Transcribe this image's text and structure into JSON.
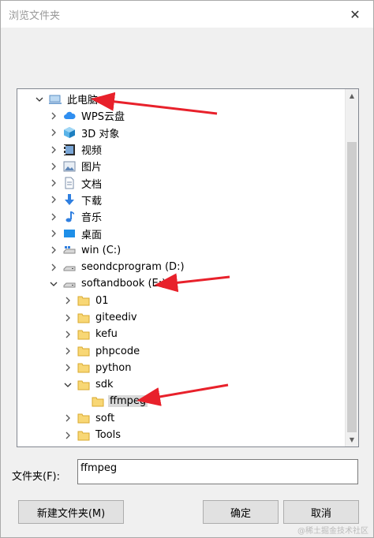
{
  "window": {
    "title": "浏览文件夹",
    "close_glyph": "✕"
  },
  "tree": {
    "items": [
      {
        "label": "此电脑",
        "indent": 0,
        "expander": "expanded",
        "icon": "computer-icon"
      },
      {
        "label": "WPS云盘",
        "indent": 1,
        "expander": "collapsed",
        "icon": "cloud-icon"
      },
      {
        "label": "3D 对象",
        "indent": 1,
        "expander": "collapsed",
        "icon": "cube-3d-icon"
      },
      {
        "label": "视频",
        "indent": 1,
        "expander": "collapsed",
        "icon": "video-icon"
      },
      {
        "label": "图片",
        "indent": 1,
        "expander": "collapsed",
        "icon": "picture-icon"
      },
      {
        "label": "文档",
        "indent": 1,
        "expander": "collapsed",
        "icon": "document-icon"
      },
      {
        "label": "下载",
        "indent": 1,
        "expander": "collapsed",
        "icon": "download-icon"
      },
      {
        "label": "音乐",
        "indent": 1,
        "expander": "collapsed",
        "icon": "music-icon"
      },
      {
        "label": "桌面",
        "indent": 1,
        "expander": "collapsed",
        "icon": "desktop-icon"
      },
      {
        "label": "win (C:)",
        "indent": 1,
        "expander": "collapsed",
        "icon": "system-drive-icon"
      },
      {
        "label": "seondcprogram (D:)",
        "indent": 1,
        "expander": "collapsed",
        "icon": "drive-icon"
      },
      {
        "label": "softandbook (E:)",
        "indent": 1,
        "expander": "expanded",
        "icon": "drive-icon"
      },
      {
        "label": "01",
        "indent": 2,
        "expander": "collapsed",
        "icon": "folder-icon"
      },
      {
        "label": "giteediv",
        "indent": 2,
        "expander": "collapsed",
        "icon": "folder-icon"
      },
      {
        "label": "kefu",
        "indent": 2,
        "expander": "collapsed",
        "icon": "folder-icon"
      },
      {
        "label": "phpcode",
        "indent": 2,
        "expander": "collapsed",
        "icon": "folder-icon"
      },
      {
        "label": "python",
        "indent": 2,
        "expander": "collapsed",
        "icon": "folder-icon"
      },
      {
        "label": "sdk",
        "indent": 2,
        "expander": "expanded",
        "icon": "folder-icon"
      },
      {
        "label": "ffmpeg",
        "indent": 3,
        "expander": "none",
        "icon": "folder-icon",
        "selected": true
      },
      {
        "label": "soft",
        "indent": 2,
        "expander": "collapsed",
        "icon": "folder-icon"
      },
      {
        "label": "Tools",
        "indent": 2,
        "expander": "collapsed",
        "icon": "folder-icon"
      }
    ]
  },
  "folder_field": {
    "label": "文件夹(F):",
    "value": "ffmpeg"
  },
  "buttons": {
    "new_folder": "新建文件夹(M)",
    "ok": "确定",
    "cancel": "取消"
  },
  "watermark": "@稀土掘金技术社区",
  "colors": {
    "annotation_red": "#e8212b",
    "folder_yellow": "#f8d775",
    "selection_gray": "#d9d9d9"
  }
}
